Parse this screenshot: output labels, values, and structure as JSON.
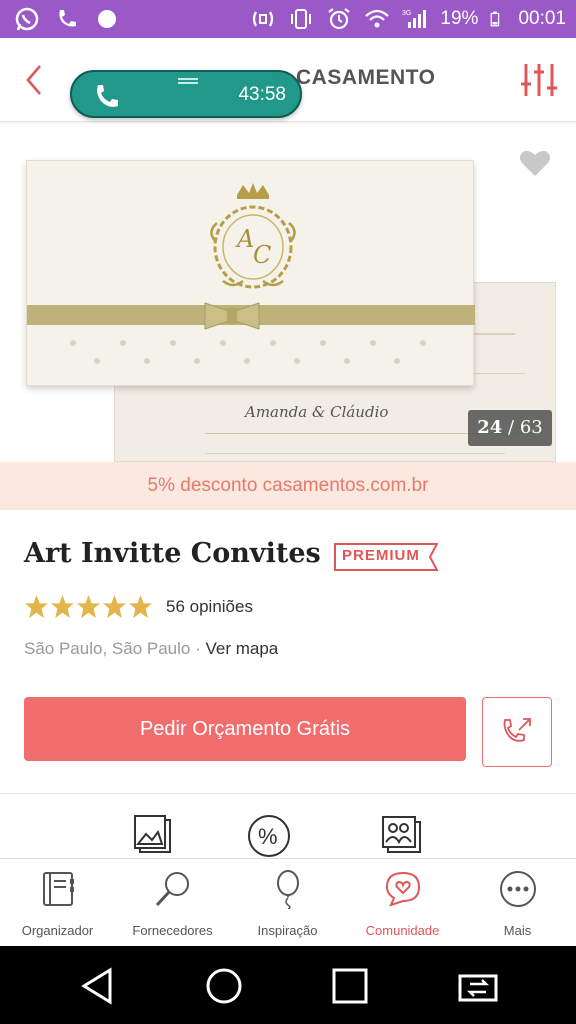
{
  "status_bar": {
    "battery": "19%",
    "time": "00:01",
    "network": "3G",
    "left_icons": [
      "whatsapp-icon",
      "phone-icon",
      "circle-icon"
    ],
    "right_icons": [
      "nfc-icon",
      "vibrate-icon",
      "alarm-icon",
      "wifi-icon",
      "signal-icon",
      "battery-icon"
    ]
  },
  "header": {
    "title": "CASAMENTO",
    "back_icon": "chevron-left-icon",
    "filter_icon": "sliders-icon"
  },
  "call_bubble": {
    "timer": "43:58"
  },
  "gallery": {
    "current": "24",
    "separator": " / ",
    "total": "63",
    "names": "Amanda  &  Cláudio",
    "monogram": "A C"
  },
  "discount_banner": "5% desconto casamentos.com.br",
  "vendor": {
    "name": "Art Invitte Convites",
    "badge": "PREMIUM",
    "rating": 5,
    "reviews": "56 opiniões",
    "location": "São Paulo, São Paulo · ",
    "map_link": "Ver mapa"
  },
  "actions": {
    "request_quote": "Pedir Orçamento Grátis",
    "call_icon": "phone-outgoing-icon"
  },
  "features": [
    "photos-icon",
    "discount-icon",
    "album-icon"
  ],
  "bottom_nav": [
    {
      "label": "Organizador",
      "icon": "notebook-icon",
      "active": false
    },
    {
      "label": "Fornecedores",
      "icon": "magnifier-icon",
      "active": false
    },
    {
      "label": "Inspiração",
      "icon": "balloon-icon",
      "active": false
    },
    {
      "label": "Comunidade",
      "icon": "chat-heart-icon",
      "active": true
    },
    {
      "label": "Mais",
      "icon": "more-icon",
      "active": false
    }
  ],
  "colors": {
    "status_bar": "#9b59c8",
    "accent": "#f26d6d",
    "active_nav": "#e0575a",
    "call_bubble": "#21988a",
    "star": "#e2b64a",
    "discount_bg": "#fbe8df"
  }
}
